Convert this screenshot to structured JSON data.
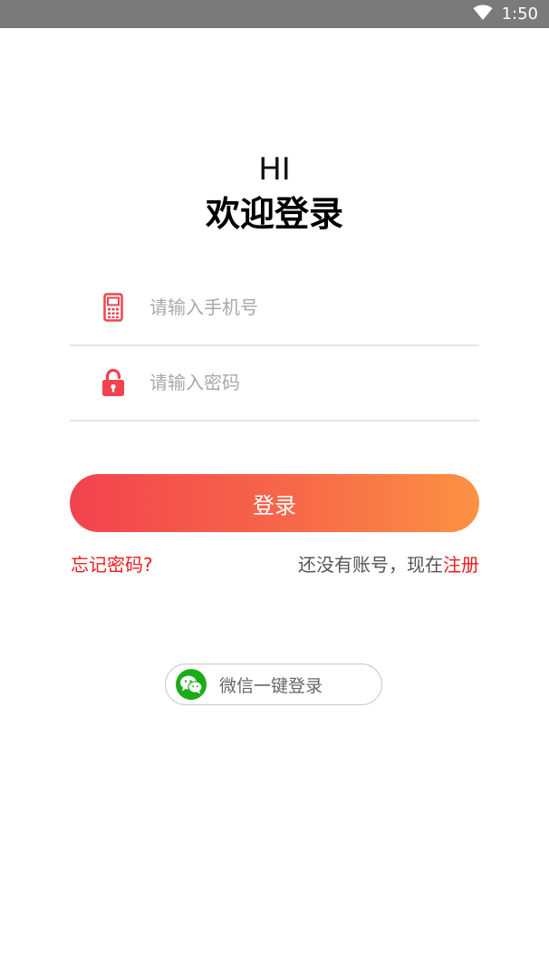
{
  "status_bar": {
    "time": "1:50",
    "wifi_icon": "wifi-icon"
  },
  "greeting": {
    "hi": "HI",
    "title": "欢迎登录"
  },
  "form": {
    "phone": {
      "icon": "mobile-phone-icon",
      "placeholder": "请输入手机号",
      "value": ""
    },
    "password": {
      "icon": "unlocked-padlock-icon",
      "placeholder": "请输入密码",
      "value": ""
    }
  },
  "login_button": {
    "label": "登录"
  },
  "links": {
    "forgot_password": "忘记密码?",
    "no_account_prefix": "还没有账号，现在",
    "register": "注册"
  },
  "wechat_login": {
    "icon": "wechat-icon",
    "label": "微信一键登录"
  },
  "colors": {
    "status_bar": "#7a7a7a",
    "accent_red": "#ee1c1c",
    "icon_red": "#f2424e",
    "gradient_start": "#f2434e",
    "gradient_end": "#fb9243",
    "wechat_green": "#1aad19"
  }
}
